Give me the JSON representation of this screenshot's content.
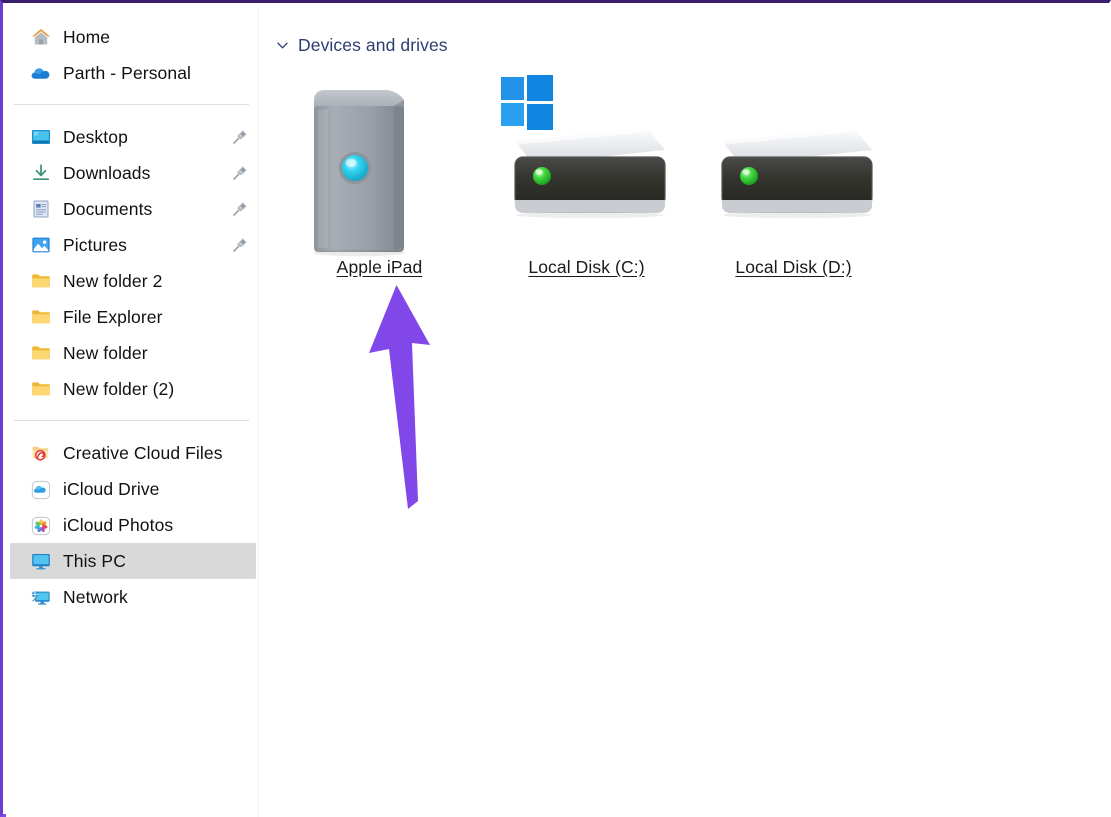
{
  "window": {
    "accent_border_color": "#8247e8",
    "background": "#ffffff"
  },
  "sidebar": {
    "groups": [
      {
        "items": [
          {
            "label": "Home",
            "icon": "home-icon",
            "pinned": false,
            "selected": false
          },
          {
            "label": "Parth - Personal",
            "icon": "onedrive-cloud-icon",
            "pinned": false,
            "selected": false
          }
        ]
      },
      {
        "items": [
          {
            "label": "Desktop",
            "icon": "desktop-icon",
            "pinned": true,
            "selected": false
          },
          {
            "label": "Downloads",
            "icon": "downloads-icon",
            "pinned": true,
            "selected": false
          },
          {
            "label": "Documents",
            "icon": "documents-icon",
            "pinned": true,
            "selected": false
          },
          {
            "label": "Pictures",
            "icon": "pictures-icon",
            "pinned": true,
            "selected": false
          },
          {
            "label": "New folder 2",
            "icon": "folder-icon",
            "pinned": false,
            "selected": false
          },
          {
            "label": "File Explorer",
            "icon": "folder-icon",
            "pinned": false,
            "selected": false
          },
          {
            "label": "New folder",
            "icon": "folder-icon",
            "pinned": false,
            "selected": false
          },
          {
            "label": "New folder (2)",
            "icon": "folder-icon",
            "pinned": false,
            "selected": false
          }
        ]
      },
      {
        "items": [
          {
            "label": "Creative Cloud Files",
            "icon": "creative-cloud-folder-icon",
            "pinned": false,
            "selected": false
          },
          {
            "label": "iCloud Drive",
            "icon": "icloud-drive-icon",
            "pinned": false,
            "selected": false
          },
          {
            "label": "iCloud Photos",
            "icon": "icloud-photos-icon",
            "pinned": false,
            "selected": false
          },
          {
            "label": "This PC",
            "icon": "this-pc-icon",
            "pinned": false,
            "selected": true
          },
          {
            "label": "Network",
            "icon": "network-icon",
            "pinned": false,
            "selected": false
          }
        ]
      }
    ],
    "selected_item": "This PC",
    "selection_color": "#d9d9d9"
  },
  "content": {
    "group_header": {
      "title": "Devices and drives",
      "expanded": true,
      "chevron": "chevron-down-icon",
      "title_color": "#2c3e70"
    },
    "drives": [
      {
        "name": "Apple iPad",
        "icon": "portable-device-icon",
        "led_color": "#22c6e8",
        "has_windows_badge": false
      },
      {
        "name": "Local Disk (C:)",
        "icon": "hard-drive-icon",
        "led_color": "#2fc62f",
        "has_windows_badge": true
      },
      {
        "name": "Local Disk (D:)",
        "icon": "hard-drive-icon",
        "led_color": "#2fc62f",
        "has_windows_badge": false
      }
    ]
  },
  "annotation": {
    "arrow": {
      "name": "purple-up-arrow",
      "color": "#8247e8",
      "points_to": "Apple iPad"
    }
  }
}
